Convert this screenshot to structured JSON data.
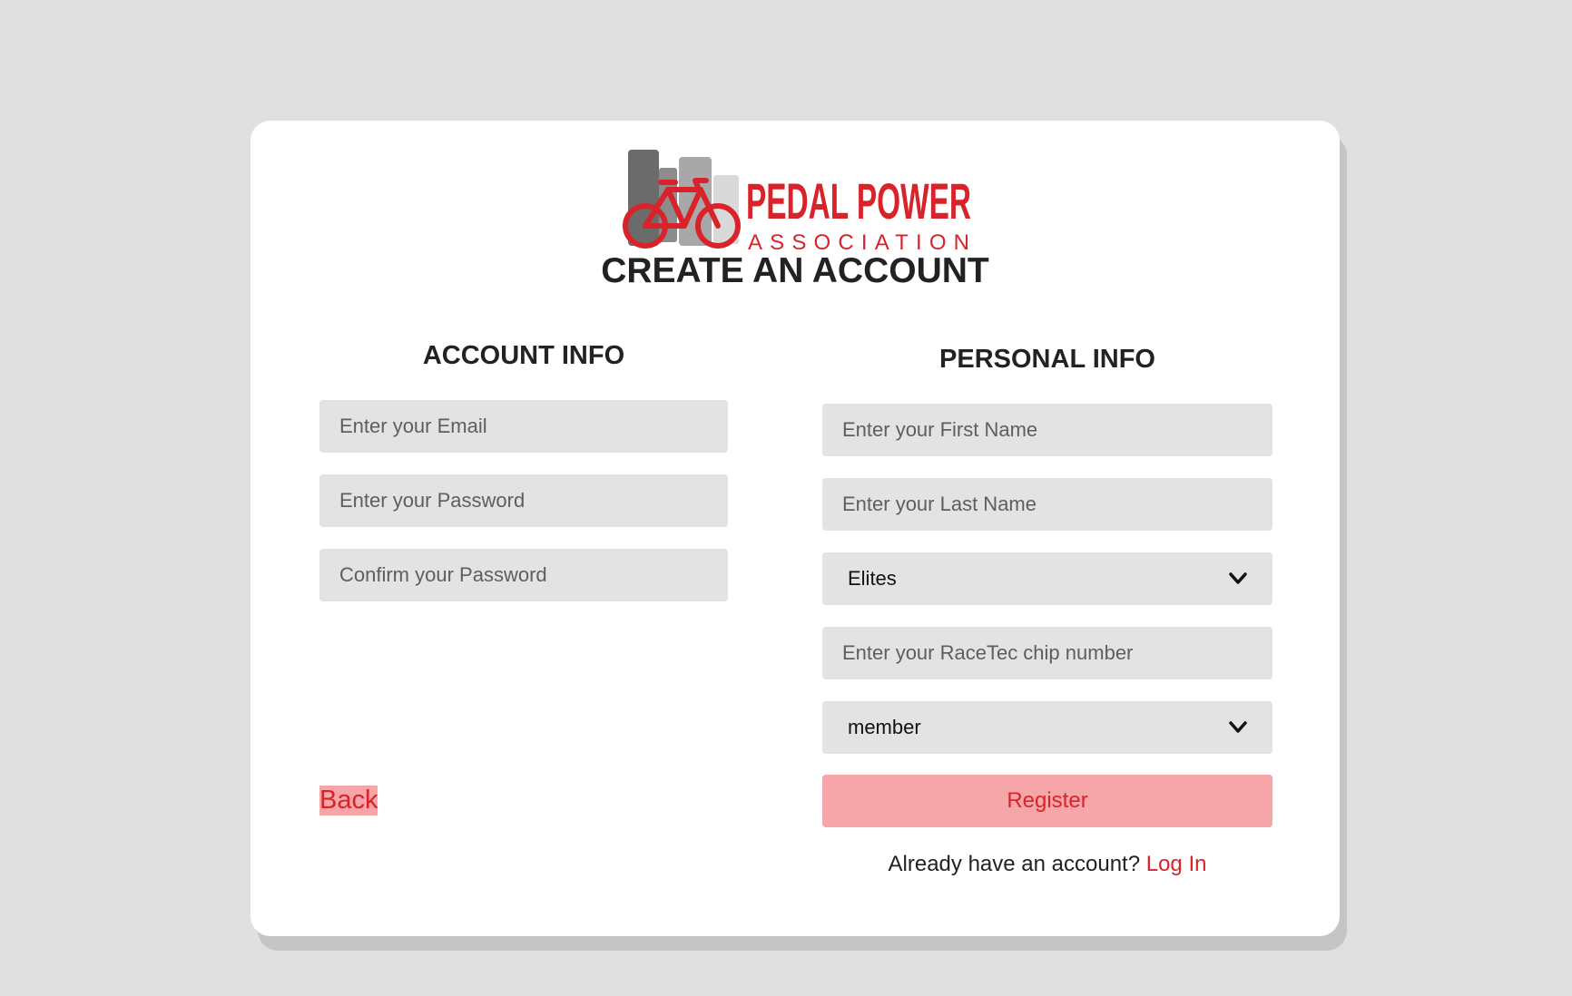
{
  "brand": {
    "name_line1": "PEDAL POWER",
    "name_line2": "ASSOCIATION",
    "colors": {
      "red": "#d8232a",
      "dark_gray": "#6b6b6b",
      "mid_gray": "#a8a8a8",
      "light_gray": "#d9d9d9"
    }
  },
  "page_title": "CREATE AN ACCOUNT",
  "account_info": {
    "heading": "ACCOUNT INFO",
    "email_placeholder": "Enter your Email",
    "password_placeholder": "Enter your Password",
    "confirm_password_placeholder": "Confirm your Password"
  },
  "personal_info": {
    "heading": "PERSONAL INFO",
    "first_name_placeholder": "Enter your First Name",
    "last_name_placeholder": "Enter your Last Name",
    "category_selected": "Elites",
    "chip_placeholder": "Enter your RaceTec chip number",
    "role_selected": "member"
  },
  "actions": {
    "back_label": "Back",
    "register_label": "Register",
    "login_prompt": "Already have an account?",
    "login_label": "Log In"
  },
  "icons": {
    "logo": "bicycle-bars-logo",
    "select_arrow": "chevron-down-icon"
  }
}
